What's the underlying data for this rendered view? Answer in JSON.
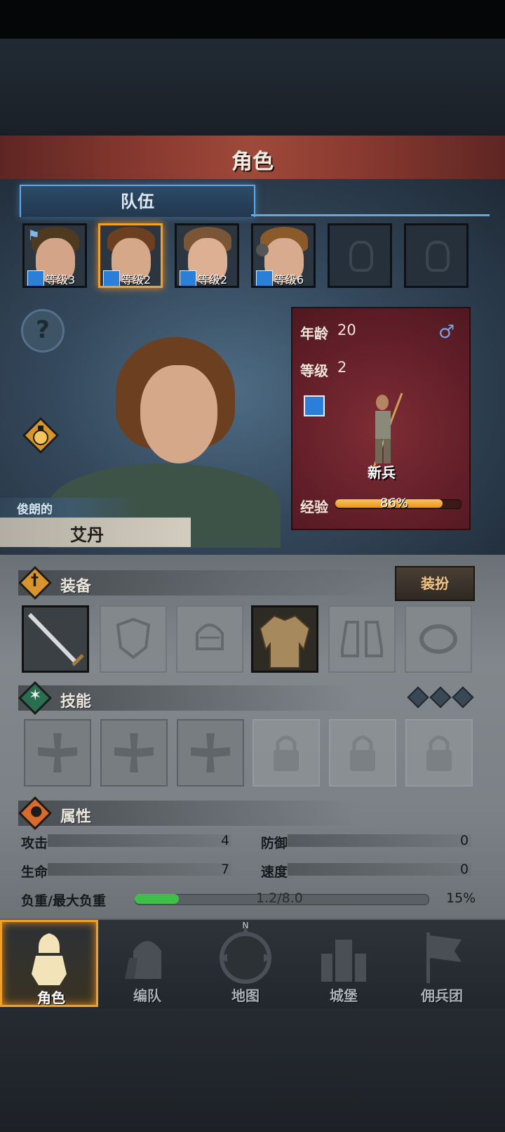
{
  "header": {
    "title": "角色"
  },
  "team": {
    "tab_label": "队伍",
    "members": [
      {
        "level_text": "等级3",
        "flag": true,
        "selected": false
      },
      {
        "level_text": "等级2",
        "flag": false,
        "selected": true
      },
      {
        "level_text": "等级2",
        "flag": false,
        "selected": false
      },
      {
        "level_text": "等级6",
        "flag": false,
        "selected": false
      }
    ],
    "empty_slots": 2
  },
  "buttons": {
    "help_symbol": "?"
  },
  "character": {
    "trait": "俊朗的",
    "name": "艾丹",
    "age_label": "年龄",
    "age": "20",
    "gender_symbol": "♂",
    "level_label": "等级",
    "level": "2",
    "class_name": "新兵",
    "xp_label": "经验",
    "xp_percent_text": "86%",
    "xp_fraction": 0.86
  },
  "equipment": {
    "title": "装备",
    "dress_button": "装扮",
    "slots": [
      "sword",
      "shield",
      "helmet",
      "shirt",
      "boots",
      "ring"
    ]
  },
  "skills": {
    "title": "技能",
    "open_slots": 3,
    "locked_slots": 3
  },
  "attributes": {
    "title": "属性",
    "attack_label": "攻击",
    "attack": "4",
    "defense_label": "防御",
    "defense": "0",
    "life_label": "生命",
    "life": "7",
    "speed_label": "速度",
    "speed": "0",
    "weight_label": "负重/最大负重",
    "weight_text": "1.2/8.0",
    "weight_percent_text": "15%",
    "weight_fraction": 0.15
  },
  "nav": {
    "items": [
      {
        "label": "角色",
        "active": true
      },
      {
        "label": "编队",
        "active": false
      },
      {
        "label": "地图",
        "active": false
      },
      {
        "label": "城堡",
        "active": false
      },
      {
        "label": "佣兵团",
        "active": false
      }
    ],
    "compass_letter": "N"
  },
  "colors": {
    "selected_border": "#f0a12a",
    "tab_border": "#5fa7e6",
    "xp_fill": "#e7961f",
    "weight_fill": "#3fbf4a",
    "panel_red": "#631f29"
  }
}
